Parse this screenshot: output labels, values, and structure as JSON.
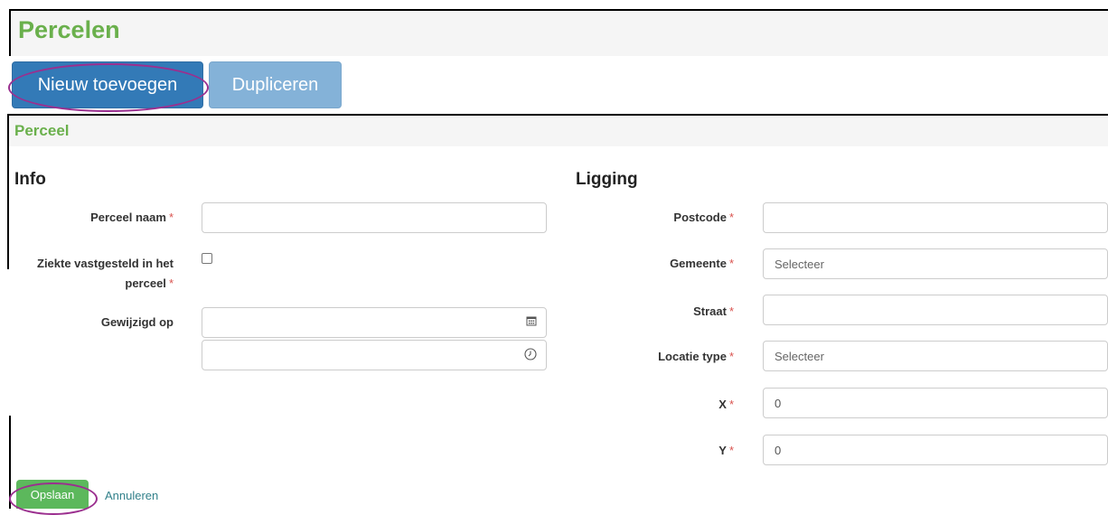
{
  "page": {
    "title": "Percelen"
  },
  "toolbar": {
    "new_label": "Nieuw toevoegen",
    "duplicate_label": "Dupliceren"
  },
  "panel": {
    "title": "Perceel"
  },
  "info": {
    "heading": "Info",
    "perceel_naam": {
      "label": "Perceel naam",
      "value": "",
      "required": "*"
    },
    "ziekte": {
      "label_line1": "Ziekte vastgesteld in het",
      "label_line2": "perceel",
      "checked": false,
      "required": "*"
    },
    "gewijzigd_op": {
      "label": "Gewijzigd op",
      "date_value": "",
      "time_value": "",
      "date_icon": "calendar-icon",
      "time_icon": "clock-icon"
    }
  },
  "ligging": {
    "heading": "Ligging",
    "postcode": {
      "label": "Postcode",
      "value": "",
      "required": "*"
    },
    "gemeente": {
      "label": "Gemeente",
      "placeholder": "Selecteer",
      "required": "*"
    },
    "straat": {
      "label": "Straat",
      "value": "",
      "required": "*"
    },
    "locatie_type": {
      "label": "Locatie type",
      "placeholder": "Selecteer",
      "required": "*"
    },
    "x": {
      "label": "X",
      "value": "0",
      "required": "*"
    },
    "y": {
      "label": "Y",
      "value": "0",
      "required": "*"
    }
  },
  "actions": {
    "save_label": "Opslaan",
    "cancel_label": "Annuleren"
  },
  "colors": {
    "title_green": "#6ab04c",
    "primary_blue": "#337ab7",
    "highlight_purple": "#9b2f8f",
    "save_green": "#5cb85c"
  }
}
